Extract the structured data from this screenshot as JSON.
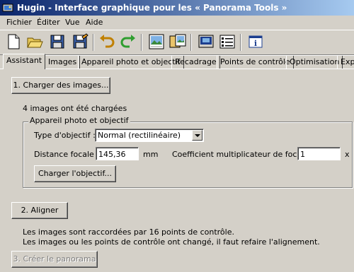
{
  "window": {
    "title": "Hugin - Interface graphique pour les « Panorama Tools »"
  },
  "menu": [
    "Fichier",
    "Éditer",
    "Vue",
    "Aide"
  ],
  "toolbar": {
    "icons": [
      "new-icon",
      "open-icon",
      "save-icon",
      "save-as-icon",
      "undo-icon",
      "redo-icon",
      "preview-icon",
      "preview-alt-icon",
      "images-icon",
      "list-icon",
      "info-icon"
    ]
  },
  "tabs": [
    "Assistant",
    "Images",
    "Appareil photo et objectif",
    "Recadrage",
    "Points de contrôle",
    "Optimisation",
    "Exp"
  ],
  "assistant": {
    "load_images_button": "1. Charger des images...",
    "images_loaded_text": "4 images ont été chargées",
    "camera_group_title": "Appareil photo et objectif",
    "lens_type_label": "Type d'objectif :",
    "lens_type_value": "Normal (rectilinéaire)",
    "focal_length_label": "Distance focale :",
    "focal_length_value": "145,36",
    "focal_unit": "mm",
    "crop_factor_label": "Coefficient multiplicateur de focale :",
    "crop_factor_value": "1",
    "crop_unit": "x",
    "load_lens_button": "Charger l'objectif...",
    "align_button": "2. Aligner",
    "status_line1": "Les images sont raccordées par 16 points de contrôle.",
    "status_line2": "Les images ou les points de contrôle ont changé, il faut refaire l'alignement.",
    "create_panorama_button": "3. Créer le panorama"
  }
}
